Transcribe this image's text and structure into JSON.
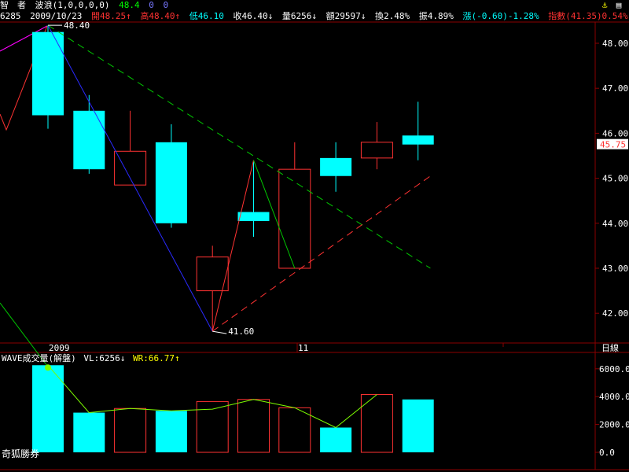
{
  "header": {
    "name": "智　者",
    "indicator": "波浪(1,0,0,0,0)",
    "values": [
      "48.4",
      "0",
      "0"
    ]
  },
  "info_bar": {
    "code": "6285",
    "date": "2009/10/23",
    "open": "開48.25↑",
    "high": "高48.40↑",
    "low": "低46.10",
    "close": "收46.40↓",
    "volume": "量6256↓",
    "amount": "額29597↓",
    "turnover": "換2.48%",
    "amplitude": "振4.89%",
    "change": "漲(-0.60)-1.28%",
    "index": "指數(41.35)0.54%"
  },
  "volume_header": {
    "label": "WAVE成交量(解盤)",
    "vl": "VL:6256↓",
    "wr": "WR:66.77↑"
  },
  "footer": {
    "broker": "奇狐勝券"
  },
  "x_axis": {
    "label_2009": "2009",
    "label_11": "11",
    "period": "日線"
  },
  "colors": {
    "up": "#ff3232",
    "down": "#00ffff",
    "background": "#000000",
    "frame": "#8b0000",
    "axis_text": "#ffffff"
  },
  "chart_data": [
    {
      "type": "candlestick",
      "title": "",
      "ylim": [
        41.4,
        48.8
      ],
      "y_ticks": [
        "48.00",
        "47.00",
        "46.00",
        "45.00",
        "44.00",
        "43.00",
        "42.00"
      ],
      "current_price_label": "45.75",
      "candles": [
        {
          "open": 48.25,
          "high": 48.4,
          "low": 46.1,
          "close": 46.4,
          "dir": "down"
        },
        {
          "open": 46.5,
          "high": 46.85,
          "low": 45.1,
          "close": 45.2,
          "dir": "down"
        },
        {
          "open": 44.85,
          "high": 46.5,
          "low": 44.85,
          "close": 45.6,
          "dir": "up"
        },
        {
          "open": 45.8,
          "high": 46.2,
          "low": 43.9,
          "close": 44.0,
          "dir": "down"
        },
        {
          "open": 42.5,
          "high": 43.5,
          "low": 41.6,
          "close": 43.25,
          "dir": "up"
        },
        {
          "open": 44.25,
          "high": 45.4,
          "low": 43.7,
          "close": 44.05,
          "dir": "down"
        },
        {
          "open": 43.0,
          "high": 45.8,
          "low": 43.0,
          "close": 45.2,
          "dir": "up"
        },
        {
          "open": 45.45,
          "high": 45.8,
          "low": 44.7,
          "close": 45.05,
          "dir": "down"
        },
        {
          "open": 45.45,
          "high": 46.25,
          "low": 45.2,
          "close": 45.8,
          "dir": "up"
        },
        {
          "open": 45.95,
          "high": 46.7,
          "low": 45.4,
          "close": 45.75,
          "dir": "down"
        }
      ],
      "wave_points": [
        {
          "bar": 0,
          "price": 48.4,
          "label": "48.40"
        },
        {
          "bar": 4,
          "price": 41.6,
          "label": "41.60"
        },
        {
          "bar": 5,
          "price": 45.4,
          "label": ""
        },
        {
          "bar": 6,
          "price": 43.0,
          "label": ""
        }
      ],
      "trend_lines": [
        {
          "name": "resistance",
          "color": "#00c800",
          "from": {
            "bar": 0,
            "price": 48.4
          },
          "to": {
            "bar": 9.3,
            "price": 43.0
          }
        },
        {
          "name": "support",
          "color": "#ff3232",
          "from": {
            "bar": 4,
            "price": 41.6
          },
          "to": {
            "bar": 9.3,
            "price": 45.05
          }
        }
      ]
    },
    {
      "type": "bar",
      "title": "",
      "ylim": [
        0,
        7000
      ],
      "y_ticks": [
        "6000.0",
        "4000.0",
        "2000.0",
        "0.0"
      ],
      "values": [
        6256,
        2850,
        3150,
        2980,
        3650,
        3800,
        3200,
        1780,
        4150,
        3800
      ],
      "dirs": [
        "down",
        "down",
        "up",
        "down",
        "up",
        "up",
        "up",
        "down",
        "up",
        "down"
      ],
      "line": [
        6256,
        2850,
        3150,
        2980,
        3100,
        3800,
        3200,
        1780,
        4150
      ]
    }
  ]
}
